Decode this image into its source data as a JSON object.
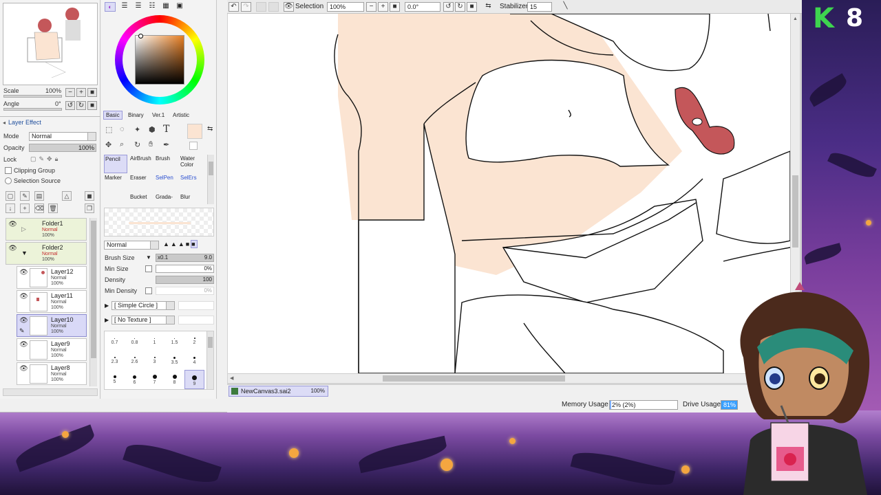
{
  "navigator": {
    "scale_label": "Scale",
    "scale_value": "100%",
    "angle_label": "Angle",
    "angle_value": "0°"
  },
  "layer_effect": {
    "header": "Layer Effect",
    "mode_label": "Mode",
    "mode_value": "Normal",
    "opacity_label": "Opacity",
    "opacity_value": "100%",
    "lock_label": "Lock",
    "clipping_group": "Clipping Group",
    "selection_source": "Selection Source"
  },
  "layers": [
    {
      "name": "Folder1",
      "mode": "Normal",
      "opacity": "100%",
      "type": "folder"
    },
    {
      "name": "Folder2",
      "mode": "Normal",
      "opacity": "100%",
      "type": "folder"
    },
    {
      "name": "Layer12",
      "mode": "Normal",
      "opacity": "100%",
      "type": "layer"
    },
    {
      "name": "Layer11",
      "mode": "Normal",
      "opacity": "100%",
      "type": "layer"
    },
    {
      "name": "Layer10",
      "mode": "Normal",
      "opacity": "100%",
      "type": "layer",
      "selected": true
    },
    {
      "name": "Layer9",
      "mode": "Normal",
      "opacity": "100%",
      "type": "layer"
    },
    {
      "name": "Layer8",
      "mode": "Normal",
      "opacity": "100%",
      "type": "layer"
    }
  ],
  "color_tabs": [
    "Basic",
    "Binary",
    "Ver.1",
    "Artistic"
  ],
  "brushes": {
    "row1": [
      "Pencil",
      "AirBrush",
      "Brush",
      "Water Color"
    ],
    "row2": [
      "Marker",
      "Eraser",
      "SelPen",
      "SelErs"
    ],
    "row3": [
      "Bucket",
      "Grada-",
      "Blur"
    ]
  },
  "brush_settings": {
    "blend_mode": "Normal",
    "size_label": "Brush Size",
    "size_multiplier": "x0.1",
    "size_value": "9.0",
    "min_size_label": "Min Size",
    "min_size_value": "0%",
    "density_label": "Density",
    "density_value": "100",
    "min_density_label": "Min Density",
    "min_density_value": "0%",
    "shape": "[ Simple Circle ]",
    "texture": "[ No Texture ]"
  },
  "dot_sizes": [
    "0.7",
    "0.8",
    "1",
    "1.5",
    "2",
    "2.3",
    "2.6",
    "3",
    "3.5",
    "4",
    "5",
    "6",
    "7",
    "8",
    "9"
  ],
  "toolbar": {
    "selection_label": "Selection",
    "zoom_value": "100%",
    "rotation_value": "0.0°",
    "stabilizer_label": "Stabilizer",
    "stabilizer_value": "15"
  },
  "document_tab": {
    "name": "NewCanvas3.sai2",
    "zoom": "100%"
  },
  "status": {
    "memory_label": "Memory Usage",
    "memory_value": "2% (2%)",
    "drive_label": "Drive Usage",
    "drive_value": "81%"
  },
  "overlay": {
    "badge_letter": "K",
    "badge_number": "8"
  },
  "colors": {
    "skin": "#fbe4d2",
    "hair": "#c4575a",
    "selection_blue": "#d9d9f7",
    "overlay_purple": "#6a3c9a"
  }
}
